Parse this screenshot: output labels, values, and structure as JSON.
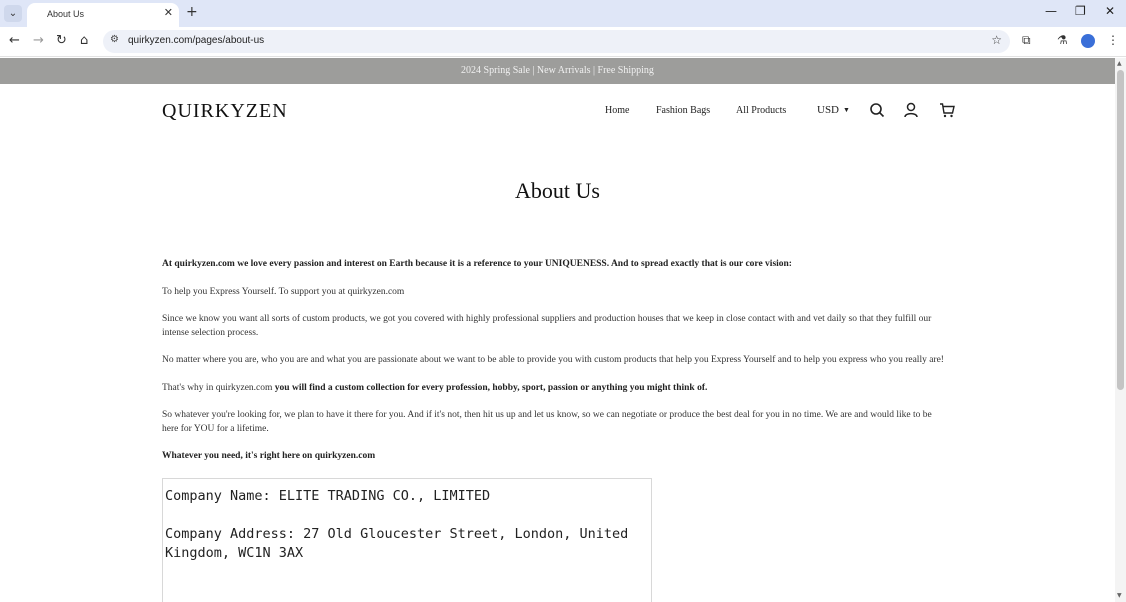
{
  "browser": {
    "tab_title": "About Us",
    "url": "quirkyzen.com/pages/about-us"
  },
  "site": {
    "announcement": "2024 Spring Sale | New Arrivals | Free Shipping",
    "logo": "QUIRKYZEN",
    "nav": [
      "Home",
      "Fashion Bags",
      "All Products"
    ],
    "currency": "USD"
  },
  "page": {
    "title": "About Us",
    "intro": "At quirkyzen.com we love every passion and interest on Earth because it is a reference to your UNIQUENESS. And to spread exactly that is our core vision:",
    "p1": "To help you Express Yourself. To support you at quirkyzen.com",
    "p2": "Since we know you want all sorts of custom products, we got you covered with highly professional suppliers and production houses that we keep in close contact with and vet daily so that they fulfill our intense selection process.",
    "p3": "No matter where you are, who you are and what you are passionate about we want to be able to provide you with custom products that help you Express Yourself and to help you express who you really are!",
    "p4_prefix": "That's why in quirkyzen.com",
    "p4_bold": "you will find a custom collection for every profession, hobby, sport, passion or anything you might think of.",
    "p5": "So whatever you're looking for, we plan to have it there for you. And if it's not, then hit us up and let us know, so we can negotiate or produce the best deal for you in no time. We are and would like to be here for YOU for a lifetime.",
    "closing": "Whatever you need, it's right here on quirkyzen.com",
    "company_name": "Company Name: ELITE TRADING CO., LIMITED",
    "company_address": "Company Address: 27 Old Gloucester Street, London, United Kingdom, WC1N 3AX"
  }
}
